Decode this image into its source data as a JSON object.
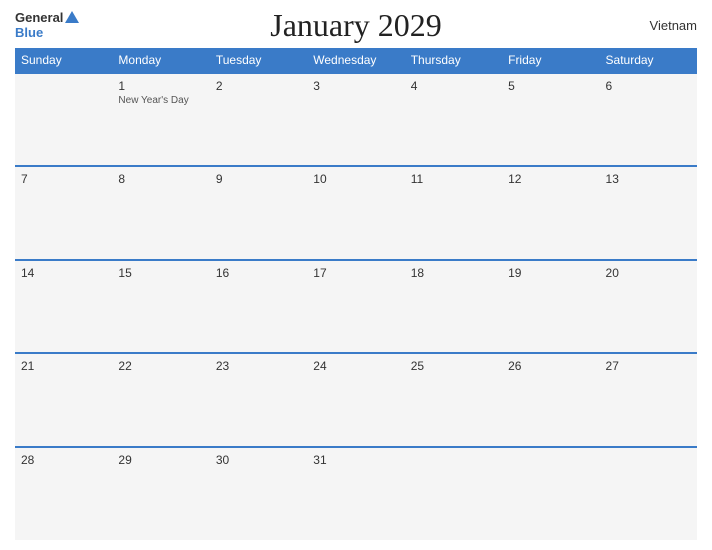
{
  "header": {
    "title": "January 2029",
    "country": "Vietnam",
    "logo_general": "General",
    "logo_blue": "Blue"
  },
  "weekdays": [
    "Sunday",
    "Monday",
    "Tuesday",
    "Wednesday",
    "Thursday",
    "Friday",
    "Saturday"
  ],
  "weeks": [
    [
      {
        "day": "",
        "holiday": ""
      },
      {
        "day": "1",
        "holiday": "New Year's Day"
      },
      {
        "day": "2",
        "holiday": ""
      },
      {
        "day": "3",
        "holiday": ""
      },
      {
        "day": "4",
        "holiday": ""
      },
      {
        "day": "5",
        "holiday": ""
      },
      {
        "day": "6",
        "holiday": ""
      }
    ],
    [
      {
        "day": "7",
        "holiday": ""
      },
      {
        "day": "8",
        "holiday": ""
      },
      {
        "day": "9",
        "holiday": ""
      },
      {
        "day": "10",
        "holiday": ""
      },
      {
        "day": "11",
        "holiday": ""
      },
      {
        "day": "12",
        "holiday": ""
      },
      {
        "day": "13",
        "holiday": ""
      }
    ],
    [
      {
        "day": "14",
        "holiday": ""
      },
      {
        "day": "15",
        "holiday": ""
      },
      {
        "day": "16",
        "holiday": ""
      },
      {
        "day": "17",
        "holiday": ""
      },
      {
        "day": "18",
        "holiday": ""
      },
      {
        "day": "19",
        "holiday": ""
      },
      {
        "day": "20",
        "holiday": ""
      }
    ],
    [
      {
        "day": "21",
        "holiday": ""
      },
      {
        "day": "22",
        "holiday": ""
      },
      {
        "day": "23",
        "holiday": ""
      },
      {
        "day": "24",
        "holiday": ""
      },
      {
        "day": "25",
        "holiday": ""
      },
      {
        "day": "26",
        "holiday": ""
      },
      {
        "day": "27",
        "holiday": ""
      }
    ],
    [
      {
        "day": "28",
        "holiday": ""
      },
      {
        "day": "29",
        "holiday": ""
      },
      {
        "day": "30",
        "holiday": ""
      },
      {
        "day": "31",
        "holiday": ""
      },
      {
        "day": "",
        "holiday": ""
      },
      {
        "day": "",
        "holiday": ""
      },
      {
        "day": "",
        "holiday": ""
      }
    ]
  ]
}
